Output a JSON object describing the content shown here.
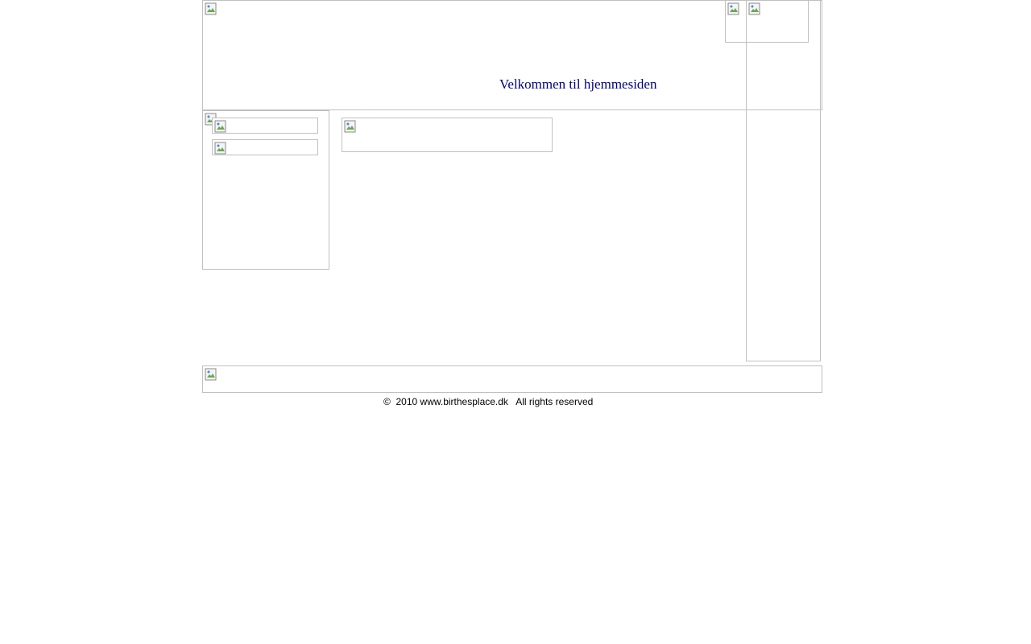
{
  "header": {
    "welcome_text": "Velkommen til hjemmesiden"
  },
  "footer": {
    "copyright_text": "©  2010 www.birthesplace.dk   All rights reserved"
  },
  "icons": {
    "placeholder": "broken-image-icon"
  }
}
